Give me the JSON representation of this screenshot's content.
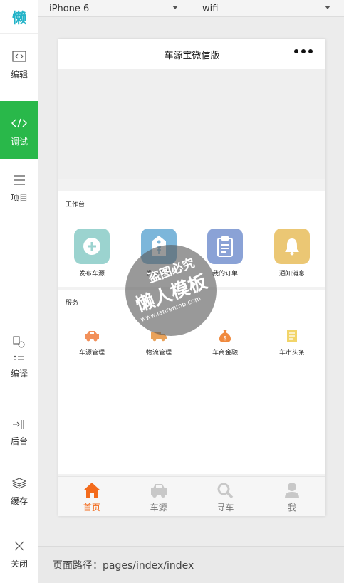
{
  "sidebar": {
    "logo": "懒",
    "items": [
      {
        "label": "编辑",
        "icon": "code-box-icon"
      },
      {
        "label": "调试",
        "icon": "code-icon",
        "active": true
      },
      {
        "label": "项目",
        "icon": "menu-lines-icon"
      },
      {
        "label": "编译",
        "icon": "compile-icon"
      },
      {
        "label": "后台",
        "icon": "background-icon"
      },
      {
        "label": "缓存",
        "icon": "layers-icon"
      },
      {
        "label": "关闭",
        "icon": "close-icon"
      }
    ]
  },
  "toolbar": {
    "device": "iPhone 6",
    "network": "wifi"
  },
  "phone": {
    "title": "车源宝微信版",
    "workbench": {
      "title": "工作台",
      "items": [
        {
          "label": "发布车源",
          "icon": "plus-circle-icon",
          "color": "#9bd3cf"
        },
        {
          "label": "发布寻车",
          "icon": "tag-icon",
          "color": "#7cb6da"
        },
        {
          "label": "我的订单",
          "icon": "clipboard-icon",
          "color": "#8aa2d6"
        },
        {
          "label": "通知消息",
          "icon": "bell-icon",
          "color": "#ebc774"
        }
      ]
    },
    "services": {
      "title": "服务",
      "items": [
        {
          "label": "车源管理",
          "icon": "car-icon",
          "color": "#f2905a"
        },
        {
          "label": "物流管理",
          "icon": "truck-icon",
          "color": "#e9a25a"
        },
        {
          "label": "车商金融",
          "icon": "money-bag-icon",
          "color": "#f08a3e"
        },
        {
          "label": "车市头条",
          "icon": "document-icon",
          "color": "#f2d56a"
        }
      ]
    },
    "tabs": [
      {
        "label": "首页",
        "icon": "home-icon",
        "active": true
      },
      {
        "label": "车源",
        "icon": "car-tab-icon"
      },
      {
        "label": "寻车",
        "icon": "search-icon"
      },
      {
        "label": "我",
        "icon": "user-icon"
      }
    ]
  },
  "watermark": {
    "line1": "盗图必究",
    "line2": "懒人模板",
    "line3": "www.lanrenmb.com"
  },
  "footer": {
    "path": "页面路径：pages/index/index"
  },
  "colors": {
    "accent_green": "#29b84a",
    "tab_active": "#f36b1c"
  }
}
